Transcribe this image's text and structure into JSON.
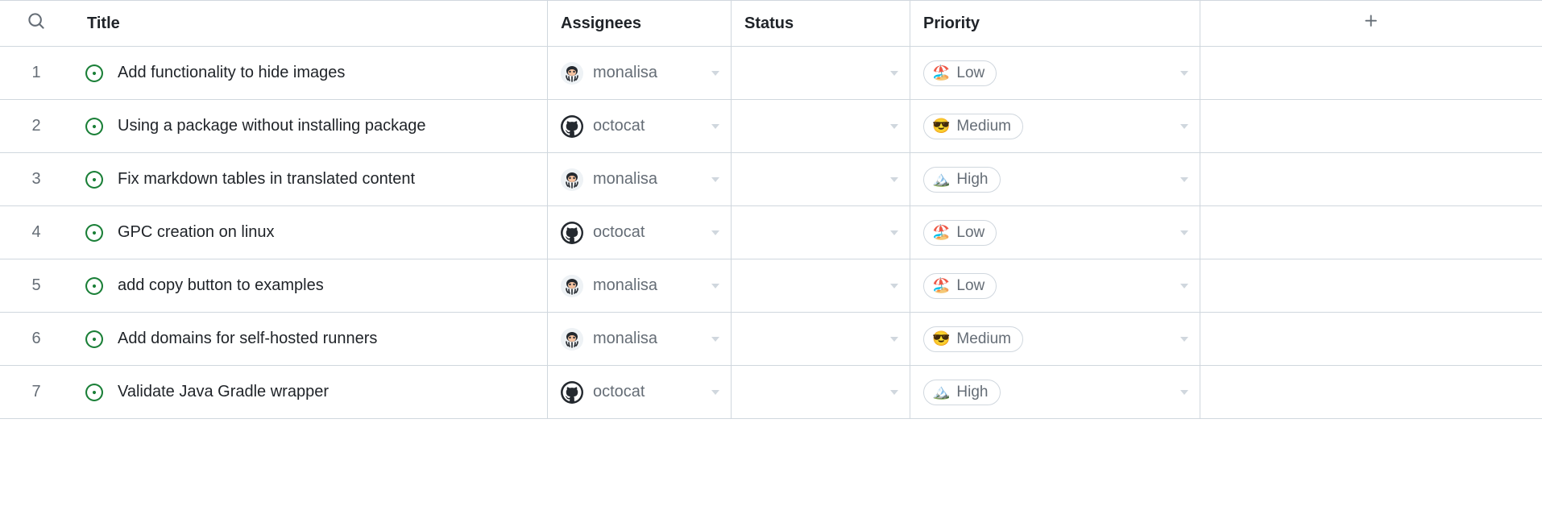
{
  "columns": {
    "title": "Title",
    "assignees": "Assignees",
    "status": "Status",
    "priority": "Priority"
  },
  "priorities": {
    "low": {
      "emoji": "🏖️",
      "label": "Low"
    },
    "medium": {
      "emoji": "😎",
      "label": "Medium"
    },
    "high": {
      "emoji": "🏔️",
      "label": "High"
    }
  },
  "assignees": {
    "monalisa": {
      "name": "monalisa",
      "avatar": "octopus"
    },
    "octocat": {
      "name": "octocat",
      "avatar": "github"
    }
  },
  "rows": [
    {
      "num": "1",
      "title": "Add functionality to hide images",
      "assignee": "monalisa",
      "status": "",
      "priority": "low"
    },
    {
      "num": "2",
      "title": "Using a package without installing package",
      "assignee": "octocat",
      "status": "",
      "priority": "medium"
    },
    {
      "num": "3",
      "title": "Fix markdown tables in translated content",
      "assignee": "monalisa",
      "status": "",
      "priority": "high"
    },
    {
      "num": "4",
      "title": "GPC creation on linux",
      "assignee": "octocat",
      "status": "",
      "priority": "low"
    },
    {
      "num": "5",
      "title": "add copy button to examples",
      "assignee": "monalisa",
      "status": "",
      "priority": "low"
    },
    {
      "num": "6",
      "title": "Add domains for self-hosted runners",
      "assignee": "monalisa",
      "status": "",
      "priority": "medium"
    },
    {
      "num": "7",
      "title": "Validate Java Gradle wrapper",
      "assignee": "octocat",
      "status": "",
      "priority": "high"
    }
  ]
}
